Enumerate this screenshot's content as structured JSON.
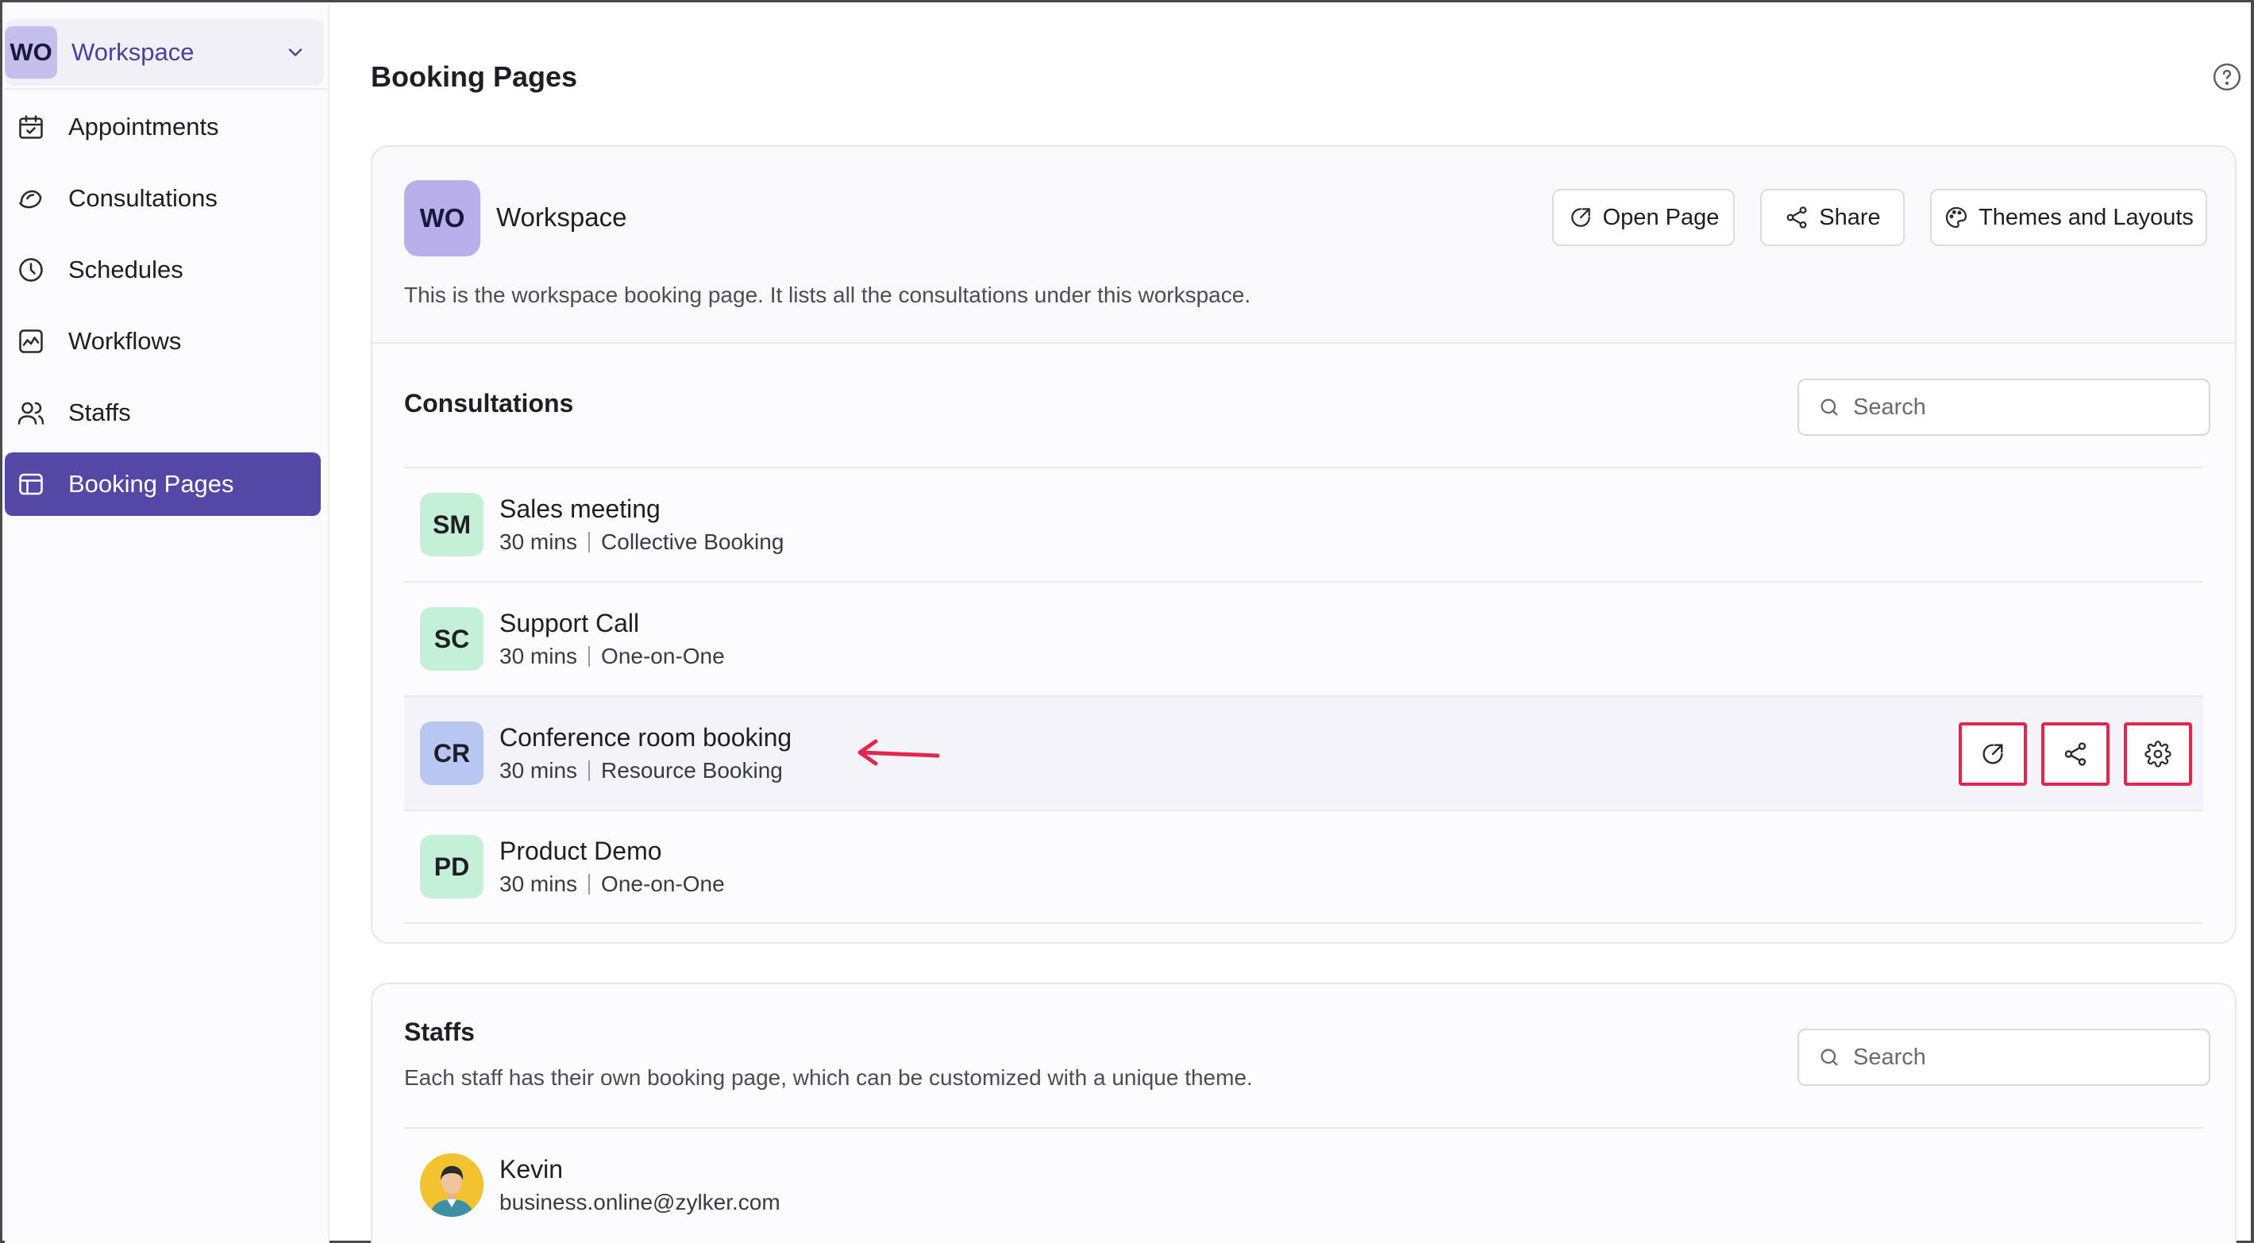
{
  "workspace_switcher": {
    "initials": "WO",
    "name": "Workspace"
  },
  "nav": [
    {
      "label": "Appointments",
      "icon": "calendar-check-icon"
    },
    {
      "label": "Consultations",
      "icon": "consultation-icon"
    },
    {
      "label": "Schedules",
      "icon": "clock-icon"
    },
    {
      "label": "Workflows",
      "icon": "workflow-chart-icon"
    },
    {
      "label": "Staffs",
      "icon": "staff-users-icon"
    },
    {
      "label": "Booking Pages",
      "icon": "booking-page-icon",
      "active": true
    }
  ],
  "page": {
    "title": "Booking Pages"
  },
  "workspace_card": {
    "initials": "WO",
    "name": "Workspace",
    "description": "This is the workspace booking page. It lists all the consultations under this workspace.",
    "buttons": {
      "open": "Open Page",
      "share": "Share",
      "themes": "Themes and Layouts"
    }
  },
  "consultations": {
    "title": "Consultations",
    "search_placeholder": "Search",
    "items": [
      {
        "initials": "SM",
        "name": "Sales meeting",
        "duration": "30 mins",
        "type": "Collective Booking",
        "color": "#c5f0d8"
      },
      {
        "initials": "SC",
        "name": "Support Call",
        "duration": "30 mins",
        "type": "One-on-One",
        "color": "#c5f0d8"
      },
      {
        "initials": "CR",
        "name": "Conference room booking",
        "duration": "30 mins",
        "type": "Resource Booking",
        "color": "#b8c6f2"
      },
      {
        "initials": "PD",
        "name": "Product Demo",
        "duration": "30 mins",
        "type": "One-on-One",
        "color": "#c5f0d8"
      }
    ]
  },
  "staffs": {
    "title": "Staffs",
    "description": "Each staff has their own booking page, which can be customized with a unique theme.",
    "search_placeholder": "Search",
    "items": [
      {
        "name": "Kevin",
        "email": "business.online@zylker.com"
      }
    ]
  },
  "colors": {
    "accent": "#5547a6",
    "highlight_border": "#e3264d"
  }
}
